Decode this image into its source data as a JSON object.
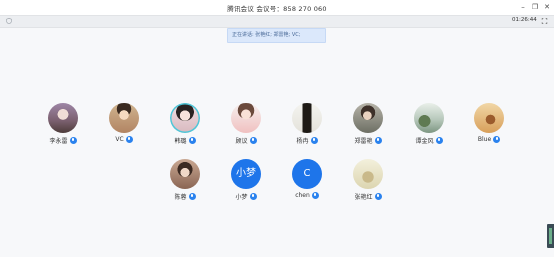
{
  "window": {
    "title": "腾讯会议 会议号：858 270 060",
    "minimize_icon": "minimize-icon",
    "restore_icon": "restore-icon",
    "close_icon": "close-icon"
  },
  "toolbar": {
    "security_icon": "shield-icon",
    "timer": "01:26:44",
    "fullscreen_icon": "fullscreen-icon"
  },
  "speaking_banner": {
    "text": "正在讲话: 张艳红; 郑雷艳; VC;"
  },
  "participants": [
    {
      "name": "李永雷",
      "avatar": "photo",
      "avatar_color": "#8f6d84"
    },
    {
      "name": "VC",
      "avatar": "photo",
      "avatar_color": "#c6a27c"
    },
    {
      "name": "韩璐",
      "avatar": "photo",
      "avatar_color": "#e3c7c9"
    },
    {
      "name": "顾议",
      "avatar": "photo",
      "avatar_color": "#e9b8b5"
    },
    {
      "name": "杨冉",
      "avatar": "photo",
      "avatar_color": "#3f3a2f"
    },
    {
      "name": "郑雷艳",
      "avatar": "photo",
      "avatar_color": "#8b8c7f"
    },
    {
      "name": "谭金风",
      "avatar": "photo",
      "avatar_color": "#8aa59a"
    },
    {
      "name": "Blue",
      "avatar": "photo",
      "avatar_color": "#d6a86a"
    },
    {
      "name": "陈蓉",
      "avatar": "photo",
      "avatar_color": "#9a7463"
    },
    {
      "name": "小梦",
      "avatar": "text",
      "avatar_text": "小梦",
      "avatar_color": "#1e75ea"
    },
    {
      "name": "chen",
      "avatar": "text",
      "avatar_text": "C",
      "avatar_color": "#1e75ea"
    },
    {
      "name": "张艳红",
      "avatar": "photo",
      "avatar_color": "#d8d4b8"
    }
  ],
  "colors": {
    "accent": "#1e75ea",
    "banner_bg": "#dbe8fb",
    "background": "#f7f8fa"
  }
}
